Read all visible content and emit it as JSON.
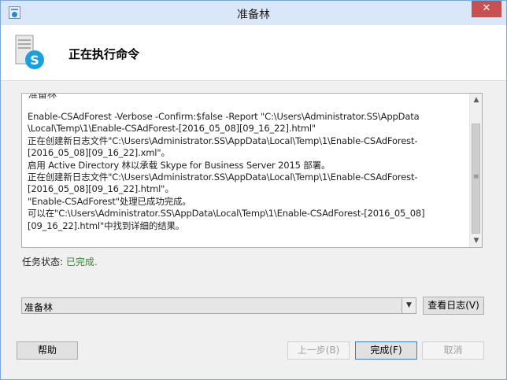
{
  "window": {
    "title": "准备林",
    "close_glyph": "✕"
  },
  "header": {
    "title": "正在执行命令",
    "icon": "skype-server-icon"
  },
  "log": {
    "fragment": "准备林",
    "lines": [
      "Enable-CSAdForest  -Verbose -Confirm:$false -Report \"C:\\Users\\Administrator.SS\\AppData",
      "\\Local\\Temp\\1\\Enable-CSAdForest-[2016_05_08][09_16_22].html\"",
      "正在创建新日志文件\"C:\\Users\\Administrator.SS\\AppData\\Local\\Temp\\1\\Enable-CSAdForest-",
      "[2016_05_08][09_16_22].xml\"。",
      "启用 Active Directory 林以承载 Skype for Business Server 2015 部署。",
      "正在创建新日志文件\"C:\\Users\\Administrator.SS\\AppData\\Local\\Temp\\1\\Enable-CSAdForest-",
      "[2016_05_08][09_16_22].html\"。",
      "\"Enable-CSAdForest\"处理已成功完成。",
      "可以在\"C:\\Users\\Administrator.SS\\AppData\\Local\\Temp\\1\\Enable-CSAdForest-[2016_05_08]",
      "[09_16_22].html\"中找到详细的结果。"
    ]
  },
  "status": {
    "label": "任务状态:",
    "value": "已完成."
  },
  "combo": {
    "selected": "准备林"
  },
  "buttons": {
    "view_log": "查看日志(V)",
    "help": "帮助",
    "back": "上一步(B)",
    "finish": "完成(F)",
    "cancel": "取消"
  }
}
